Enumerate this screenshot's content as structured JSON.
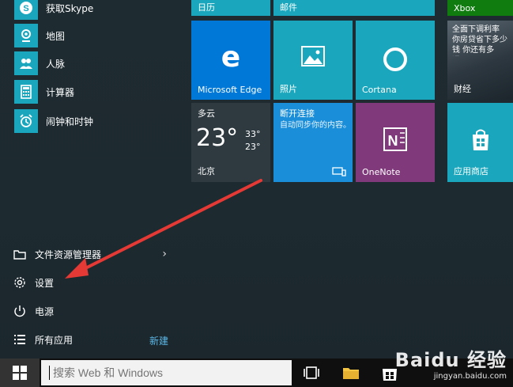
{
  "apps": [
    {
      "label": "获取Skype",
      "icon": "skype-icon"
    },
    {
      "label": "地图",
      "icon": "maps-icon"
    },
    {
      "label": "人脉",
      "icon": "people-icon"
    },
    {
      "label": "计算器",
      "icon": "calculator-icon"
    },
    {
      "label": "闹钟和时钟",
      "icon": "alarm-clock-icon"
    }
  ],
  "bottom": {
    "file_explorer": "文件资源管理器",
    "settings": "设置",
    "power": "电源",
    "all_apps": "所有应用",
    "new": "新建"
  },
  "tiles": {
    "calendar": "日历",
    "mail": "邮件",
    "xbox": "Xbox",
    "edge": "Microsoft Edge",
    "photos": "照片",
    "cortana": "Cortana",
    "finance_title": "全面下调利率 你房贷省下多少钱 你还有多远？",
    "finance": "财经",
    "weather_condition": "多云",
    "weather_temp": "23°",
    "weather_high": "33°",
    "weather_low": "23°",
    "weather_city": "北京",
    "connect_title": "断开连接",
    "connect_desc": "自动同步你的内容。",
    "onenote": "OneNote",
    "store": "应用商店"
  },
  "taskbar": {
    "search_placeholder": "搜索 Web 和 Windows"
  },
  "watermark": {
    "brand": "Baidu 经验",
    "url": "jingyan.baidu.com"
  },
  "colors": {
    "accent": "#1aa7bd",
    "edge_tile": "#0078d7",
    "xbox_tile": "#107c10",
    "onenote_tile": "#80397b"
  }
}
